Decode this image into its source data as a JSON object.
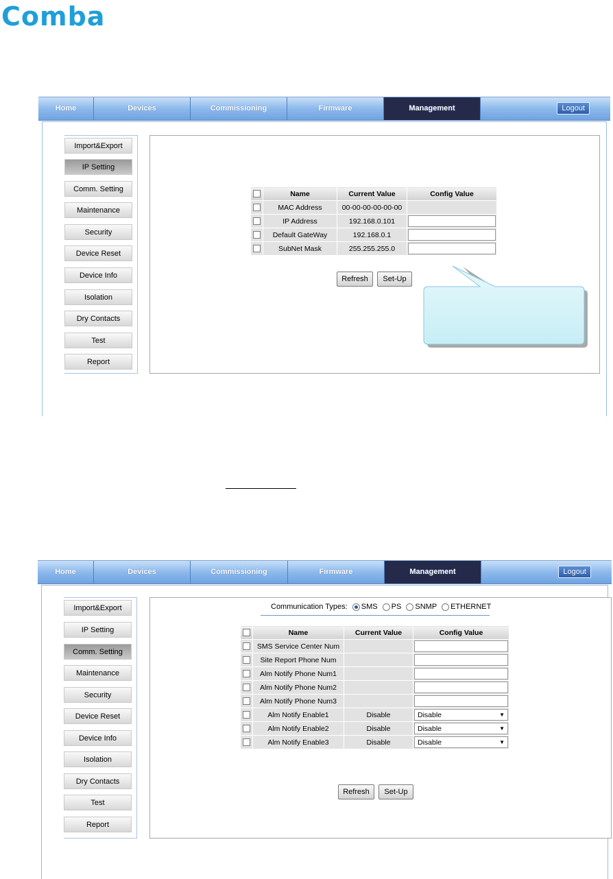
{
  "logo": {
    "text": "Comba",
    "color": "#1f9fd8"
  },
  "nav": {
    "tabs": [
      "Home",
      "Devices",
      "Commissioning",
      "Firmware",
      "Management"
    ],
    "active_tab": "Management",
    "logout_label": "Logout"
  },
  "sidebar": {
    "items": [
      "Import&Export",
      "IP Setting",
      "Comm. Setting",
      "Maintenance",
      "Security",
      "Device Reset",
      "Device Info",
      "Isolation",
      "Dry Contacts",
      "Test",
      "Report"
    ]
  },
  "ip_screen": {
    "selected_item": "IP Setting",
    "columns": [
      "Name",
      "Current Value",
      "Config Value"
    ],
    "rows": [
      {
        "name": "MAC Address",
        "current": "00-00-00-00-00-00",
        "config": ""
      },
      {
        "name": "IP Address",
        "current": "192.168.0.101",
        "config": ""
      },
      {
        "name": "Default GateWay",
        "current": "192.168.0.1",
        "config": ""
      },
      {
        "name": "SubNet Mask",
        "current": "255.255.255.0",
        "config": ""
      }
    ],
    "refresh_label": "Refresh",
    "setup_label": "Set-Up"
  },
  "comm_screen": {
    "selected_item": "Comm. Setting",
    "comm_types_label": "Communication Types:",
    "comm_types": [
      "SMS",
      "PS",
      "SNMP",
      "ETHERNET"
    ],
    "comm_type_selected": "SMS",
    "columns": [
      "Name",
      "Current Value",
      "Config Value"
    ],
    "rows": [
      {
        "name": "SMS Service Center Num",
        "current": "",
        "config": ""
      },
      {
        "name": "Site Report Phone Num",
        "current": "",
        "config": ""
      },
      {
        "name": "Alm Notify Phone Num1",
        "current": "",
        "config": ""
      },
      {
        "name": "Alm Notify Phone Num2",
        "current": "",
        "config": ""
      },
      {
        "name": "Alm Notify Phone Num3",
        "current": "",
        "config": ""
      },
      {
        "name": "Alm Notify Enable1",
        "current": "Disable",
        "config": "Disable"
      },
      {
        "name": "Alm Notify Enable2",
        "current": "Disable",
        "config": "Disable"
      },
      {
        "name": "Alm Notify Enable3",
        "current": "Disable",
        "config": "Disable"
      }
    ],
    "refresh_label": "Refresh",
    "setup_label": "Set-Up"
  }
}
